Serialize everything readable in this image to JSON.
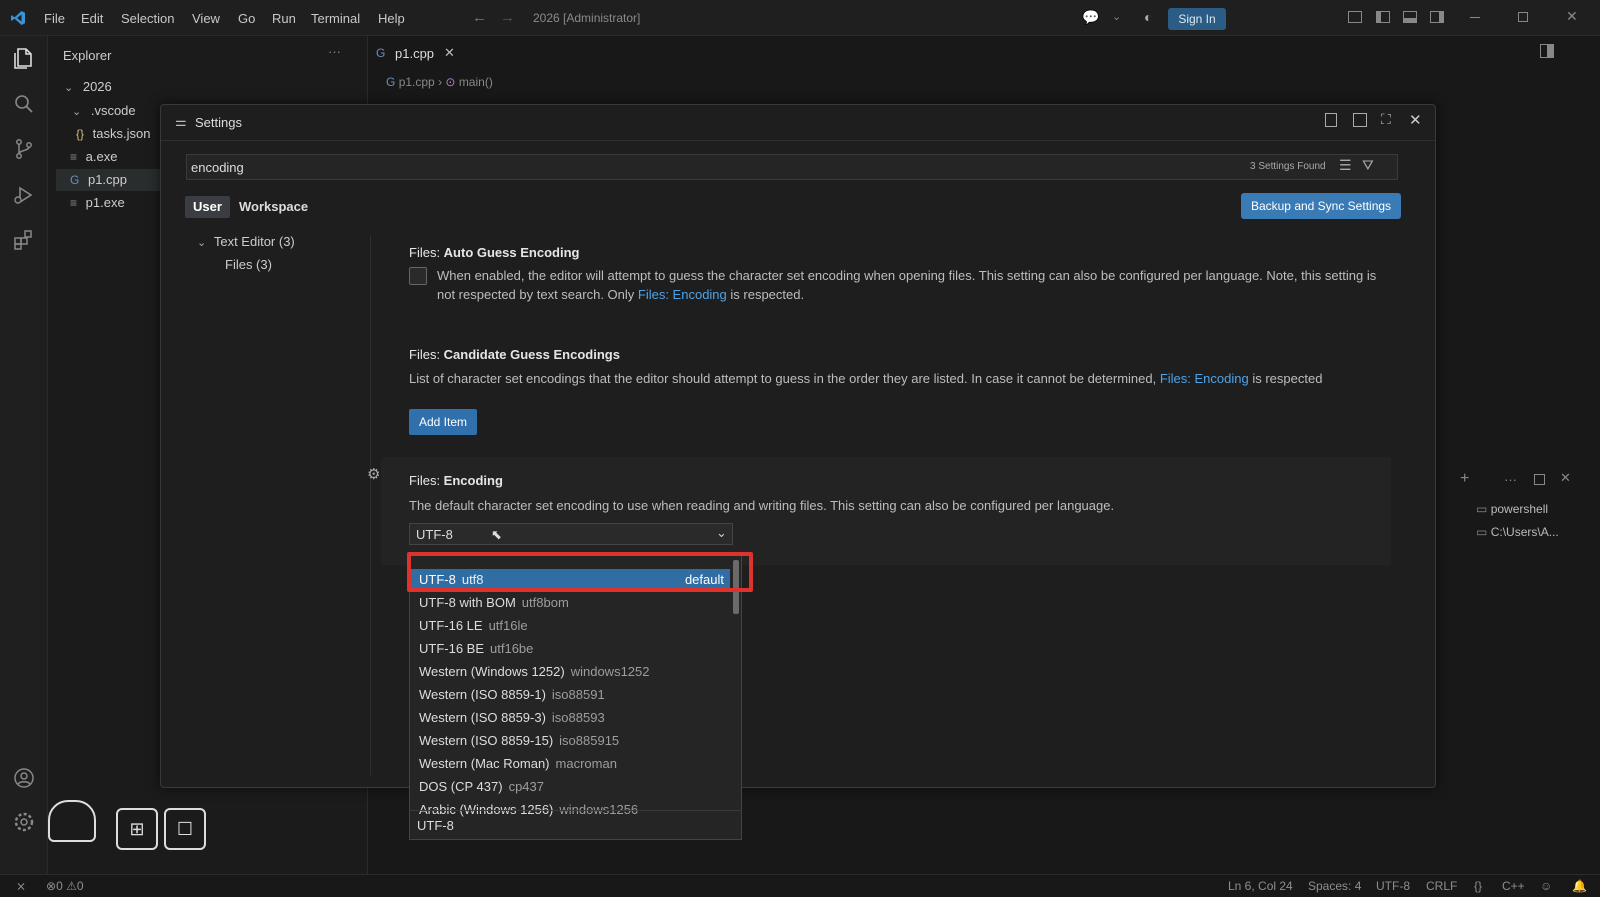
{
  "titlebar": {
    "menus": [
      "File",
      "Edit",
      "Selection",
      "View",
      "Go",
      "Run",
      "Terminal",
      "Help"
    ],
    "window_title": "2026 [Administrator]",
    "sign_in": "Sign In"
  },
  "explorer": {
    "title": "Explorer",
    "items": [
      {
        "label": "2026",
        "icon": "chevron-down-icon"
      },
      {
        "label": ".vscode",
        "icon": "chevron-down-icon"
      },
      {
        "label": "tasks.json",
        "icon": "json-icon"
      },
      {
        "label": "a.exe",
        "icon": "file-icon"
      },
      {
        "label": "p1.cpp",
        "icon": "cpp-icon"
      },
      {
        "label": "p1.exe",
        "icon": "file-icon"
      }
    ]
  },
  "editor": {
    "tab": "p1.cpp",
    "breadcrumb": [
      "p1.cpp",
      "main()"
    ]
  },
  "settings": {
    "title": "Settings",
    "search_value": "encoding",
    "found": "3 Settings Found",
    "scopes": [
      "User",
      "Workspace"
    ],
    "backup_sync": "Backup and Sync Settings",
    "toc": [
      {
        "label": "Text Editor (3)"
      },
      {
        "label": "Files (3)"
      }
    ],
    "items": [
      {
        "category": "Files: ",
        "name": "Auto Guess Encoding",
        "desc_before": "When enabled, the editor will attempt to guess the character set encoding when opening files. This setting can also be configured per language. Note, this setting is not respected by text search. Only ",
        "link": "Files: Encoding",
        "desc_after": " is respected."
      },
      {
        "category": "Files: ",
        "name": "Candidate Guess Encodings",
        "desc_before": "List of character set encodings that the editor should attempt to guess in the order they are listed. In case it cannot be determined, ",
        "link": "Files: Encoding",
        "desc_after": " is respected",
        "button": "Add Item"
      },
      {
        "category": "Files: ",
        "name": "Encoding",
        "desc": "The default character set encoding to use when reading and writing files. This setting can also be configured per language.",
        "value": "UTF-8"
      }
    ]
  },
  "dropdown": {
    "options": [
      {
        "label": "UTF-8",
        "id": "utf8",
        "extra": "default"
      },
      {
        "label": "UTF-8 with BOM",
        "id": "utf8bom",
        "extra": ""
      },
      {
        "label": "UTF-16 LE",
        "id": "utf16le",
        "extra": ""
      },
      {
        "label": "UTF-16 BE",
        "id": "utf16be",
        "extra": ""
      },
      {
        "label": "Western (Windows 1252)",
        "id": "windows1252",
        "extra": ""
      },
      {
        "label": "Western (ISO 8859-1)",
        "id": "iso88591",
        "extra": ""
      },
      {
        "label": "Western (ISO 8859-3)",
        "id": "iso88593",
        "extra": ""
      },
      {
        "label": "Western (ISO 8859-15)",
        "id": "iso885915",
        "extra": ""
      },
      {
        "label": "Western (Mac Roman)",
        "id": "macroman",
        "extra": ""
      },
      {
        "label": "DOS (CP 437)",
        "id": "cp437",
        "extra": ""
      },
      {
        "label": "Arabic (Windows 1256)",
        "id": "windows1256",
        "extra": ""
      }
    ],
    "footer": "UTF-8"
  },
  "terminal_list": [
    "powershell",
    "C:\\Users\\A..."
  ],
  "statusbar": {
    "problems_errors": "0",
    "problems_warnings": "0",
    "position": "Ln 6, Col 24",
    "spaces": "Spaces: 4",
    "encoding": "UTF-8",
    "eol": "CRLF",
    "language": "C++"
  },
  "colors": {
    "accent": "#3b7bb5",
    "highlight_box": "#e0322c",
    "link": "#4fa3e8"
  }
}
